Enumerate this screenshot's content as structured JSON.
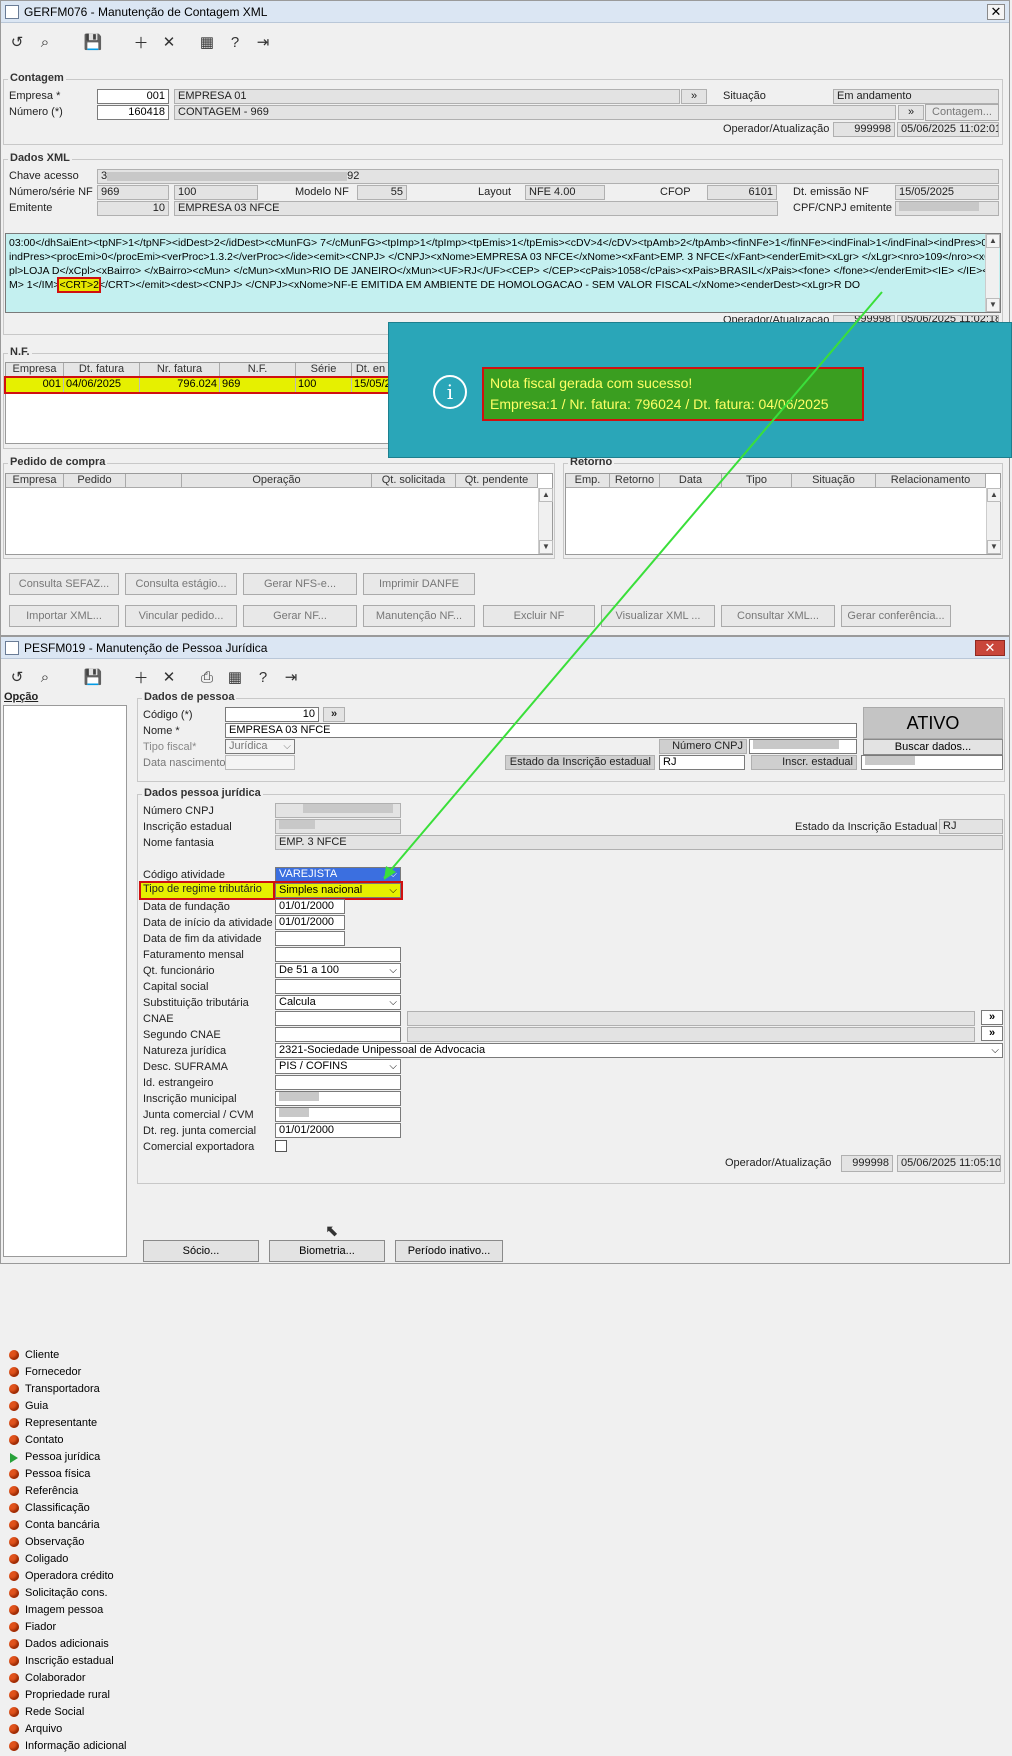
{
  "win1": {
    "title": "GERFM076 - Manutenção de Contagem XML",
    "contagem": {
      "legend": "Contagem",
      "empresa_label": "Empresa *",
      "empresa_code": "001",
      "empresa_name": "EMPRESA 01",
      "numero_label": "Número (*)",
      "numero_value": "160418",
      "numero_desc": "CONTAGEM - 969",
      "situacao_label": "Situação",
      "situacao_value": "Em andamento",
      "contagem_btn": "Contagem...",
      "operador_label": "Operador/Atualização",
      "operador_value": "999998",
      "atualizacao_value": "05/06/2025 11:02:01"
    },
    "dados_xml": {
      "legend": "Dados XML",
      "chave_label": "Chave acesso",
      "chave_value_start": "3",
      "chave_value_end": "92",
      "numserie_label": "Número/série NF",
      "numero_nf": "969",
      "serie_nf": "100",
      "modelo_label": "Modelo NF",
      "modelo_value": "55",
      "layout_label": "Layout",
      "layout_value": "NFE 4.00",
      "cfop_label": "CFOP",
      "cfop_value": "6101",
      "dt_emissao_label": "Dt. emissão NF",
      "dt_emissao_value": "15/05/2025",
      "emitente_label": "Emitente",
      "emitente_code": "10",
      "emitente_name": "EMPRESA 03 NFCE",
      "cpf_label": "CPF/CNPJ emitente",
      "xml_line1": "03:00</dhSaiEnt><tpNF>1</tpNF><idDest>2</idDest><cMunFG>        7</cMunFG><tpImp>1</tpImp><tpEmis>1</tpEmis><cDV>4</cDV><tpAmb>2</tpAmb><finNFe>1</finNFe><indFinal>1</indFinal><indPres>0</indPres><procEmi>0</procEmi><verProc>1.3.2</verProc></ide><emit><CNPJ>               </CNPJ><xNome>EMPRESA 03 NFCE</xNome><xFant>EMP. 3 NFCE</xFant><enderEmit><xLgr>                      </xLgr><nro>109</nro><xCpl>LOJA D</xCpl><xBairro>              </xBairro><cMun>         </cMun><xMun>RIO DE JANEIRO</xMun><UF>RJ</UF><CEP>          </CEP><cPais>1058</cPais><xPais>BRASIL</xPais><fone>              </fone></enderEmit><IE>         </IE><IM>       1</IM>",
      "xml_crt": "<CRT>2",
      "xml_line2": "</CRT></emit><dest><CNPJ>              </CNPJ><xNome>NF-E EMITIDA EM AMBIENTE DE HOMOLOGACAO - SEM VALOR FISCAL</xNome><enderDest><xLgr>R DO",
      "operador_label2": "Operador/Atualização",
      "operador_value2": "999998",
      "atualizacao_value2": "05/06/2025 11:02:18"
    },
    "nf": {
      "legend": "N.F.",
      "headers": [
        "Empresa",
        "Dt. fatura",
        "Nr. fatura",
        "N.F.",
        "Série",
        "Dt. en"
      ],
      "row": [
        "001",
        "04/06/2025",
        "796.024",
        "969",
        "100",
        "15/05/2"
      ]
    },
    "pedido": {
      "legend": "Pedido de compra",
      "headers": [
        "Empresa",
        "Pedido",
        "",
        "Operação",
        "Qt. solicitada",
        "Qt. pendente"
      ]
    },
    "retorno": {
      "legend": "Retorno",
      "headers": [
        "Emp.",
        "Retorno",
        "Data",
        "Tipo",
        "Situação",
        "Relacionamento"
      ]
    },
    "buttons_row1": [
      "Consulta SEFAZ...",
      "Consulta estágio...",
      "Gerar NFS-e...",
      "Imprimir DANFE"
    ],
    "buttons_row2": [
      "Importar XML...",
      "Vincular pedido...",
      "Gerar NF...",
      "Manutenção NF...",
      "Excluir NF",
      "Visualizar XML ...",
      "Consultar XML...",
      "Gerar conferência..."
    ]
  },
  "toast": {
    "line1": "Nota fiscal gerada com sucesso!",
    "line2": "Empresa:1 / Nr. fatura: 796024 / Dt. fatura: 04/06/2025",
    "bg": "#2aa6b8",
    "text_color": "#ffff66",
    "highlight_bg": "#3a9e20"
  },
  "win2": {
    "title": "PESFM019 - Manutenção de Pessoa Jurídica",
    "nav_title": "Opção",
    "nav_items": [
      "Cliente",
      "Fornecedor",
      "Transportadora",
      "Guia",
      "Representante",
      "Contato",
      "Pessoa jurídica",
      "Pessoa física",
      "Referência",
      "Classificação",
      "Conta bancária",
      "Observação",
      "Coligado",
      "Operadora crédito",
      "Solicitação cons.",
      "Imagem pessoa",
      "Fiador",
      "Dados adicionais",
      "Inscrição estadual",
      "Colaborador",
      "Propriedade rural",
      "Rede Social",
      "Arquivo",
      "Informação adicional"
    ],
    "dados_pessoa": {
      "legend": "Dados de pessoa",
      "codigo_label": "Código (*)",
      "codigo_value": "10",
      "nome_label": "Nome *",
      "nome_value": "EMPRESA 03 NFCE",
      "tipo_fiscal_label": "Tipo fiscal*",
      "tipo_fiscal_value": "Jurídica",
      "dt_nasc_label": "Data nascimento",
      "status": "ATIVO",
      "numero_cnpj_label": "Número CNPJ",
      "buscar_btn": "Buscar dados...",
      "estado_insc_label": "Estado da Inscrição estadual",
      "estado_insc_value": "RJ",
      "insc_estadual_label": "Inscr. estadual"
    },
    "dados_pj": {
      "legend": "Dados pessoa jurídica",
      "numero_cnpj_label": "Número CNPJ",
      "insc_estadual_label": "Inscrição estadual",
      "estado_insc_label": "Estado da Inscrição Estadual",
      "estado_insc_value": "RJ",
      "nome_fantasia_label": "Nome fantasia",
      "nome_fantasia_value": "EMP. 3 NFCE",
      "cod_atividade_label": "Código atividade",
      "cod_atividade_value": "VAREJISTA",
      "regime_label": "Tipo de regime tributário",
      "regime_value": "Simples nacional",
      "dt_fundacao_label": "Data de fundação",
      "dt_fundacao_value": "01/01/2000",
      "dt_inicio_label": "Data de início da atividade",
      "dt_inicio_value": "01/01/2000",
      "dt_fim_label": "Data de fim da atividade",
      "faturamento_label": "Faturamento mensal",
      "qt_func_label": "Qt. funcionário",
      "qt_func_value": "De 51 a 100",
      "capital_label": "Capital social",
      "subst_label": "Substituição tributária",
      "subst_value": "Calcula",
      "cnae_label": "CNAE",
      "segundo_cnae_label": "Segundo CNAE",
      "natureza_label": "Natureza jurídica",
      "natureza_value": "2321-Sociedade Unipessoal de Advocacia",
      "suframa_label": "Desc. SUFRAMA",
      "suframa_value": "PIS / COFINS",
      "id_estrangeiro_label": "Id. estrangeiro",
      "insc_municipal_label": "Inscrição municipal",
      "junta_label": "Junta comercial / CVM",
      "dt_junta_label": "Dt. reg. junta comercial",
      "dt_junta_value": "01/01/2000",
      "exportadora_label": "Comercial exportadora",
      "operador_label": "Operador/Atualização",
      "operador_value": "999998",
      "atualizacao_value": "05/06/2025 11:05:10"
    },
    "bottom_buttons": [
      "Sócio...",
      "Biometria...",
      "Período inativo..."
    ]
  }
}
